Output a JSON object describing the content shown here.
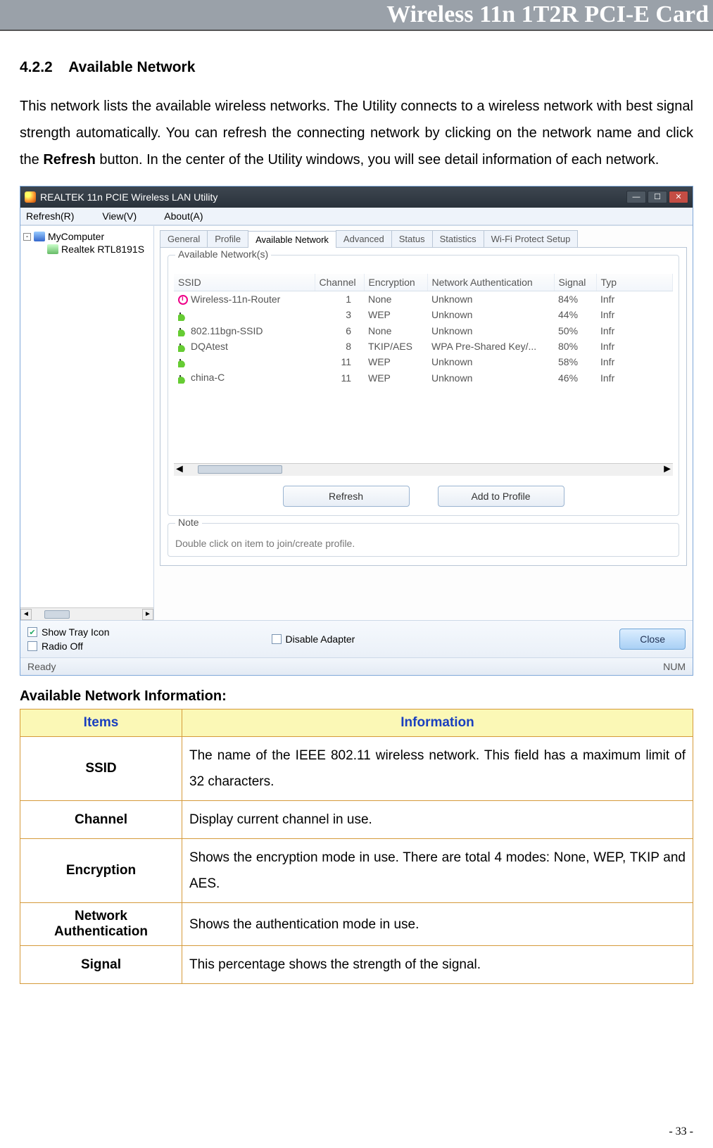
{
  "header": {
    "title": "Wireless 11n 1T2R PCI-E Card"
  },
  "section": {
    "number": "4.2.2",
    "title": "Available Network",
    "paragraph_pre": "This network lists the available wireless networks. The Utility connects to a wireless network with best signal strength automatically. You can refresh the connecting network by clicking on the network name and click the ",
    "paragraph_bold": "Refresh",
    "paragraph_post": " button. In the center of the Utility windows, you will see detail information of each network."
  },
  "app": {
    "window_title": "REALTEK 11n PCIE Wireless LAN Utility",
    "menu": {
      "refresh": "Refresh(R)",
      "view": "View(V)",
      "about": "About(A)"
    },
    "tree": {
      "root": "MyComputer",
      "child": "Realtek RTL8191S"
    },
    "tabs": [
      "General",
      "Profile",
      "Available Network",
      "Advanced",
      "Status",
      "Statistics",
      "Wi-Fi Protect Setup"
    ],
    "active_tab_index": 2,
    "group_legend": "Available Network(s)",
    "columns": [
      "SSID",
      "Channel",
      "Encryption",
      "Network Authentication",
      "Signal",
      "Typ"
    ],
    "rows": [
      {
        "icon": "info",
        "ssid": "Wireless-11n-Router",
        "channel": "1",
        "enc": "None",
        "auth": "Unknown",
        "signal": "84%",
        "type": "Infr"
      },
      {
        "icon": "sig",
        "ssid": "",
        "channel": "3",
        "enc": "WEP",
        "auth": "Unknown",
        "signal": "44%",
        "type": "Infr"
      },
      {
        "icon": "sig",
        "ssid": "802.11bgn-SSID",
        "channel": "6",
        "enc": "None",
        "auth": "Unknown",
        "signal": "50%",
        "type": "Infr"
      },
      {
        "icon": "sig",
        "ssid": "DQAtest",
        "channel": "8",
        "enc": "TKIP/AES",
        "auth": "WPA Pre-Shared Key/...",
        "signal": "80%",
        "type": "Infr"
      },
      {
        "icon": "sig",
        "ssid": "",
        "channel": "11",
        "enc": "WEP",
        "auth": "Unknown",
        "signal": "58%",
        "type": "Infr"
      },
      {
        "icon": "sig",
        "ssid": "china-C",
        "channel": "11",
        "enc": "WEP",
        "auth": "Unknown",
        "signal": "46%",
        "type": "Infr"
      }
    ],
    "buttons": {
      "refresh": "Refresh",
      "add": "Add to Profile"
    },
    "note_legend": "Note",
    "note_text": "Double click on item to join/create profile.",
    "footer": {
      "show_tray": "Show Tray Icon",
      "radio_off": "Radio Off",
      "disable_adapter": "Disable Adapter",
      "close": "Close"
    },
    "status": {
      "left": "Ready",
      "right": "NUM"
    }
  },
  "info_heading": "Available Network Information:",
  "info_table": {
    "headers": [
      "Items",
      "Information"
    ],
    "rows": [
      {
        "item": "SSID",
        "info": "The name of the IEEE 802.11 wireless network. This field has a maximum limit of 32 characters."
      },
      {
        "item": "Channel",
        "info": "Display current channel in use."
      },
      {
        "item": "Encryption",
        "info": "Shows the encryption mode in use. There are total 4 modes: None, WEP, TKIP and AES."
      },
      {
        "item": "Network Authentication",
        "info": "Shows the authentication mode in use."
      },
      {
        "item": "Signal",
        "info": "This percentage shows the strength of the signal."
      }
    ]
  },
  "page_number": "- 33 -"
}
